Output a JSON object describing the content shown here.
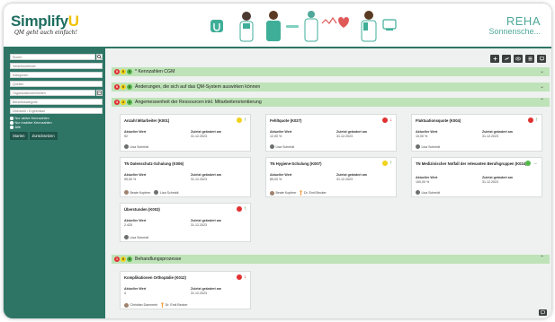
{
  "header": {
    "logo_main": "Simplify",
    "logo_u": "U",
    "logo_sub": "QM geht auch einfach!",
    "brand_line1": "REHA",
    "brand_line2": "Sonnensche..."
  },
  "sidebar": {
    "search_placeholder": "Suche",
    "fields": [
      "Verantwortlicher",
      "Kategorien",
      "Quellen",
      "Organisationseinheiten",
      "Berichtskategorie",
      "Übersicht / Ergebnisse"
    ],
    "radios": [
      {
        "label": "Nur aktive Kennzahlen",
        "checked": true
      },
      {
        "label": "Nur inaktive Kennzahlen",
        "checked": false
      },
      {
        "label": "Alle",
        "checked": false
      }
    ],
    "start_label": "Starten",
    "reset_label": "Zurücksetzen"
  },
  "toolbar": {
    "icons": [
      "plus-icon",
      "chart-icon",
      "eye-icon",
      "list-icon",
      "monitor-icon"
    ]
  },
  "sections": [
    {
      "title": "* Kennzahlen CGM",
      "counts": [
        "0",
        "0",
        "0"
      ],
      "expanded": false
    },
    {
      "title": "Änderungen, die sich auf das QM-System auswirken können",
      "counts": [
        "0",
        "0",
        "0"
      ],
      "expanded": false
    },
    {
      "title": "Angemessenheit der Ressourcen inkl. Mitarbeiterorientierung",
      "counts": [
        "3",
        "2",
        "1"
      ],
      "expanded": true
    },
    {
      "title": "Behandlungsprozesse",
      "counts": [
        "1",
        "0",
        "0"
      ],
      "expanded": true
    }
  ],
  "cards": [
    {
      "title": "Anzahl Mitarbeiter (K001)",
      "status": "yellow",
      "trend": "up",
      "label_current": "Aktueller Wert",
      "current": "92",
      "label_changed": "Zuletzt geändert am",
      "changed": "31.12.2023",
      "persons": [
        "Lisa Schmidt"
      ]
    },
    {
      "title": "Fehltquote (K027)",
      "status": "red",
      "trend": "down",
      "label_current": "Aktueller Wert",
      "current": "12,00 %",
      "label_changed": "Zuletzt geändert am",
      "changed": "31.12.2023",
      "persons": [
        "Lisa Schmidt"
      ]
    },
    {
      "title": "Fluktuationsquote (K004)",
      "status": "red",
      "trend": "up",
      "label_current": "Aktueller Wert",
      "current": "10,00 %",
      "label_changed": "Zuletzt geändert am",
      "changed": "31.12.2023",
      "persons": [
        "Lisa Schmidt"
      ]
    },
    {
      "title": "TN Datenschutz-Schulung (K006)",
      "status": "",
      "trend": "",
      "label_current": "Aktueller Wert",
      "current": "95,00 %",
      "label_changed": "Zuletzt geändert am",
      "changed": "31.12.2023",
      "persons": [
        "Beate Kopfner",
        "Lisa Schmidt"
      ]
    },
    {
      "title": "TN Hygiene-Schulung (K007)",
      "status": "yellow",
      "trend": "up",
      "label_current": "Aktueller Wert",
      "current": "85,00 %",
      "label_changed": "Zuletzt geändert am",
      "changed": "31.12.2023",
      "persons": [
        "Beate Kopfner",
        "Dr. Emil Becker"
      ]
    },
    {
      "title": "TN Medizinischer Notfall der relevanten Berufsgruppen (K024)",
      "status": "green",
      "trend": "right",
      "label_current": "Aktueller Wert",
      "current": "100,00 %",
      "label_changed": "Zuletzt geändert am",
      "changed": "31.12.2023",
      "persons": [
        "Lisa Schmidt"
      ]
    },
    {
      "title": "Überstunden (K003)",
      "status": "red",
      "trend": "up",
      "label_current": "Aktueller Wert",
      "current": "2.425",
      "label_changed": "Zuletzt geändert am",
      "changed": "31.12.2023",
      "persons": [
        "Lisa Schmidt"
      ]
    },
    {
      "title": "Komplikationen Orthopädie (K012)",
      "status": "red",
      "trend": "down",
      "label_current": "Aktueller Wert",
      "current": "4",
      "label_changed": "Zuletzt geändert am",
      "changed": "31.12.2023",
      "persons": [
        "Christian Dannmeir",
        "Dr. Emil Becker"
      ]
    }
  ],
  "colors": {
    "brand": "#2e7566",
    "section_bg": "#bfe3b8",
    "red": "#e03030",
    "yellow": "#f1d21a",
    "green": "#55b849",
    "arrow_green": "#2b8a2b",
    "arrow_red": "#cc2222"
  }
}
